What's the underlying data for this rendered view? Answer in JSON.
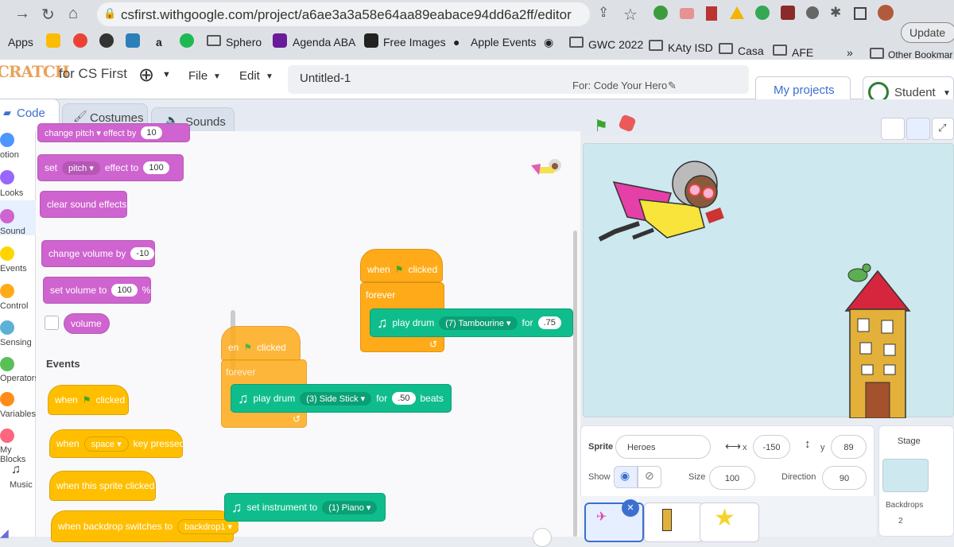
{
  "browser": {
    "url": "csfirst.withgoogle.com/project/a6ae3a3a58e64aa89eabace94dd6a2ff/editor",
    "update": "Update",
    "bookmarks": [
      "Apps",
      "Sphero",
      "Agenda ABA",
      "Free Images",
      "Apple Events",
      "GWC 2022",
      "KAty ISD",
      "Casa",
      "AFE",
      "»",
      "Other Bookmar"
    ]
  },
  "header": {
    "logo": "CRATCH",
    "brand": "for CS First",
    "file": "File",
    "edit": "Edit",
    "title": "Untitled-1",
    "for_label": "For: Code Your Hero",
    "my_projects": "My projects",
    "student": "Student"
  },
  "tabs": {
    "code": "Code",
    "costumes": "Costumes",
    "sounds": "Sounds"
  },
  "categories": [
    {
      "label": "otion",
      "color": "#4c97ff"
    },
    {
      "label": "Looks",
      "color": "#9966ff"
    },
    {
      "label": "Sound",
      "color": "#cf63cf"
    },
    {
      "label": "Events",
      "color": "#ffd500"
    },
    {
      "label": "Control",
      "color": "#ffab19"
    },
    {
      "label": "Sensing",
      "color": "#5cb1d6"
    },
    {
      "label": "Operators",
      "color": "#59c059"
    },
    {
      "label": "Variables",
      "color": "#ff8c1a"
    },
    {
      "label": "My Blocks",
      "color": "#ff6680"
    },
    {
      "label": "Music",
      "color": "#ffffff"
    }
  ],
  "palette": {
    "change_pitch": "change  pitch ▾  effect by",
    "change_pitch_val": "10",
    "set": "set",
    "pitch": "pitch",
    "effect_to": "effect to",
    "effect_val": "100",
    "clear": "clear sound effects",
    "change_vol": "change volume by",
    "change_vol_val": "-10",
    "set_vol": "set volume to",
    "set_vol_val": "100",
    "pct": "%",
    "volume": "volume",
    "events_head": "Events",
    "when": "when",
    "clicked": "clicked",
    "space": "space",
    "key_pressed": "key pressed",
    "sprite_clicked": "when this sprite clicked",
    "backdrop_switch": "when backdrop switches to",
    "backdrop1": "backdrop1"
  },
  "scripts": {
    "s1_when": "when",
    "s1_clicked": "clicked",
    "s1_forever": "forever",
    "s1_play": "play drum",
    "s1_drum": "(7) Tambourine",
    "s1_for": "for",
    "s1_beats": ".75",
    "s2_when": "en",
    "s2_clicked": "clicked",
    "s2_forever": "forever",
    "s2_play": "play drum",
    "s2_drum": "(3) Side Stick",
    "s2_for": "for",
    "s2_beats": ".50",
    "s2_unit": "beats",
    "s3_set": "set instrument to",
    "s3_inst": "(1) Piano"
  },
  "sprite": {
    "label": "Sprite",
    "name": "Heroes",
    "x_label": "x",
    "x": "-150",
    "y_label": "y",
    "y": "89",
    "show": "Show",
    "size_label": "Size",
    "size": "100",
    "dir_label": "Direction",
    "dir": "90"
  },
  "stage_pane": {
    "label": "Stage",
    "backdrops": "Backdrops",
    "count": "2"
  }
}
